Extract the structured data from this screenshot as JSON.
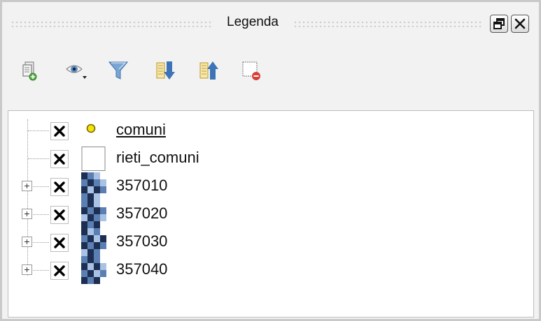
{
  "panel": {
    "title": "Legenda"
  },
  "toolbar": {
    "items": [
      {
        "name": "add-group-icon"
      },
      {
        "name": "visibility-menu-icon"
      },
      {
        "name": "filter-icon"
      },
      {
        "name": "expand-all-icon"
      },
      {
        "name": "collapse-all-icon"
      },
      {
        "name": "remove-layer-icon"
      }
    ]
  },
  "layers": [
    {
      "label": "comuni",
      "checked": true,
      "symbol": "point",
      "expandable": false,
      "underline": true
    },
    {
      "label": "rieti_comuni",
      "checked": true,
      "symbol": "polygon-white",
      "expandable": false,
      "underline": false
    },
    {
      "label": "357010",
      "checked": true,
      "symbol": "raster",
      "expandable": true,
      "underline": false
    },
    {
      "label": "357020",
      "checked": true,
      "symbol": "raster",
      "expandable": true,
      "underline": false
    },
    {
      "label": "357030",
      "checked": true,
      "symbol": "raster",
      "expandable": true,
      "underline": false
    },
    {
      "label": "357040",
      "checked": true,
      "symbol": "raster",
      "expandable": true,
      "underline": false
    }
  ],
  "colors": {
    "point_fill": "#f4e400",
    "point_stroke": "#7a6a00",
    "raster_dark": "#1c2f52",
    "raster_mid": "#5b7fb3",
    "raster_light": "#a9c2e3"
  }
}
